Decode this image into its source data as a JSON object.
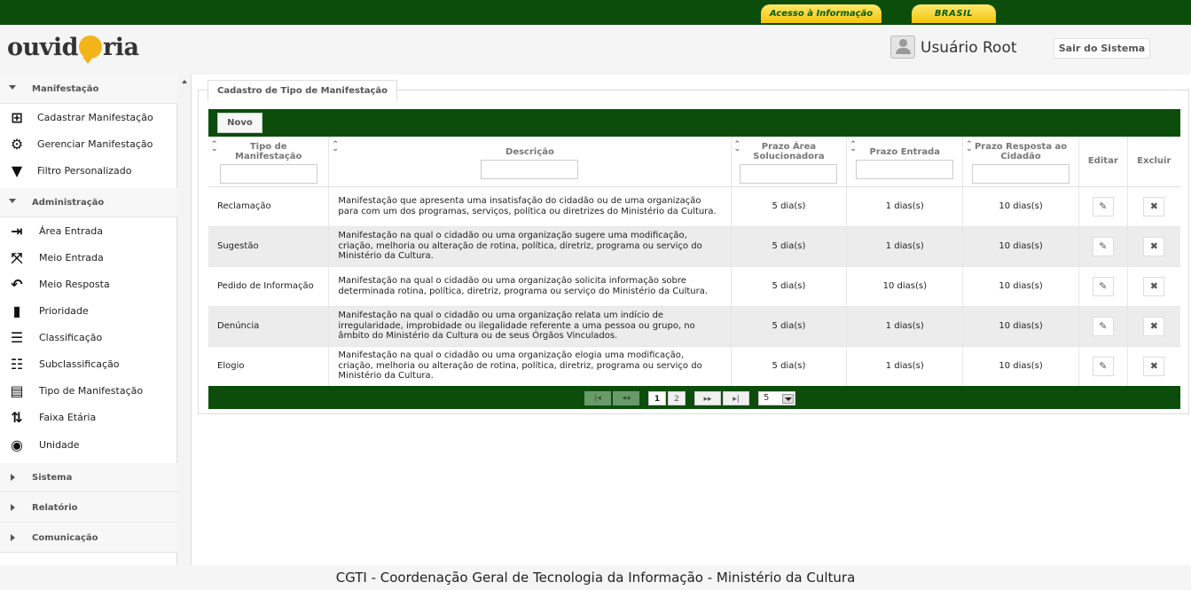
{
  "gov_bar": {
    "acesso": "Acesso à Informação",
    "brasil": "BRASIL"
  },
  "header": {
    "logo": {
      "part1": "ouvid",
      "part2": "ria"
    },
    "user": "Usuário Root",
    "logout": "Sair do Sistema"
  },
  "sidebar": {
    "sections": [
      {
        "label": "Manifestação",
        "expanded": true
      },
      {
        "label": "Administração",
        "expanded": true
      },
      {
        "label": "Sistema",
        "expanded": false
      },
      {
        "label": "Relatório",
        "expanded": false
      },
      {
        "label": "Comunicação",
        "expanded": false
      }
    ],
    "manifestacao_items": [
      {
        "label": "Cadastrar Manifestação",
        "icon": "add-box-icon"
      },
      {
        "label": "Gerenciar Manifestação",
        "icon": "gear-icon"
      },
      {
        "label": "Filtro Personalizado",
        "icon": "filter-icon"
      }
    ],
    "admin_items": [
      {
        "label": "Área Entrada",
        "icon": "login-icon"
      },
      {
        "label": "Meio Entrada",
        "icon": "collapse-icon"
      },
      {
        "label": "Meio Resposta",
        "icon": "reply-users-icon"
      },
      {
        "label": "Prioridade",
        "icon": "bookmark-icon"
      },
      {
        "label": "Classificação",
        "icon": "list-icon"
      },
      {
        "label": "Subclassificação",
        "icon": "sublist-icon"
      },
      {
        "label": "Tipo de Manifestação",
        "icon": "document-icon"
      },
      {
        "label": "Faixa Etária",
        "icon": "sort-numeric-icon"
      },
      {
        "label": "Unidade",
        "icon": "radio-icon"
      }
    ]
  },
  "panel": {
    "title": "Cadastro de Tipo de Manifestação",
    "new_button": "Novo",
    "columns": [
      "Tipo de Manifestação",
      "Descrição",
      "Prazo Área Solucionadora",
      "Prazo Entrada",
      "Prazo Resposta ao Cidadão",
      "Editar",
      "Excluir"
    ],
    "rows": [
      {
        "tipo": "Reclamação",
        "descricao": "Manifestação que apresenta uma insatisfação do cidadão ou de uma organização para com um dos programas, serviços, política ou diretrizes do Ministério da Cultura.",
        "prazo_area": "5 dia(s)",
        "prazo_entrada": "1 dias(s)",
        "prazo_resposta": "10 dias(s)"
      },
      {
        "tipo": "Sugestão",
        "descricao": "Manifestação na qual o cidadão ou uma organização sugere uma modificação, criação, melhoria ou alteração de rotina, política, diretriz, programa ou serviço do Ministério da Cultura.",
        "prazo_area": "5 dia(s)",
        "prazo_entrada": "1 dias(s)",
        "prazo_resposta": "10 dias(s)"
      },
      {
        "tipo": "Pedido de Informação",
        "descricao": "Manifestação na qual o cidadão ou uma organização solicita informação sobre determinada rotina, política, diretriz, programa ou serviço do Ministério da Cultura.",
        "prazo_area": "5 dia(s)",
        "prazo_entrada": "10 dias(s)",
        "prazo_resposta": "10 dias(s)"
      },
      {
        "tipo": "Denúncia",
        "descricao": "Manifestação na qual o cidadão ou uma organização relata um indício de irregularidade, improbidade ou ilegalidade referente a uma pessoa ou grupo, no âmbito do Ministério da Cultura ou de seus Órgãos Vinculados.",
        "prazo_area": "5 dia(s)",
        "prazo_entrada": "1 dias(s)",
        "prazo_resposta": "10 dias(s)"
      },
      {
        "tipo": "Elogio",
        "descricao": "Manifestação na qual o cidadão ou uma organização elogia uma modificação, criação, melhoria ou alteração de rotina, política, diretriz, programa ou serviço do Ministério da Cultura.",
        "prazo_area": "5 dia(s)",
        "prazo_entrada": "1 dias(s)",
        "prazo_resposta": "10 dias(s)"
      }
    ],
    "pager": {
      "pages": [
        "1",
        "2"
      ],
      "current_page": "1",
      "rows_per_page": "5"
    }
  },
  "footer": "CGTI - Coordenação Geral de Tecnologia da Informação - Ministério da Cultura",
  "colors": {
    "gov_green": "#0c4d0c",
    "gov_yellow": "#f2c40c",
    "logo_orange": "#f3b31a"
  }
}
